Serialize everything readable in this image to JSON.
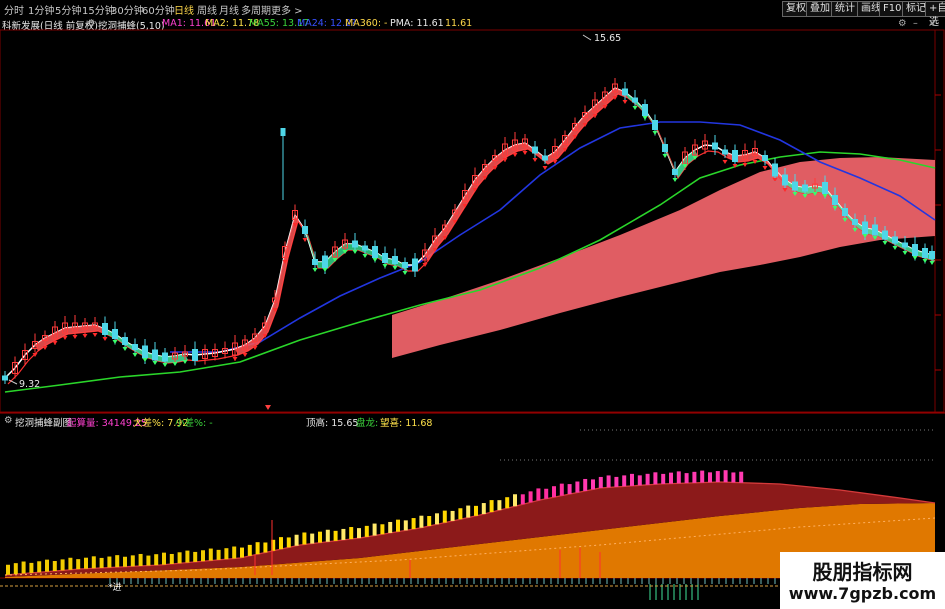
{
  "toolbar": {
    "timeframes": [
      {
        "label": "分时",
        "active": false
      },
      {
        "label": "1分钟",
        "active": false
      },
      {
        "label": "5分钟",
        "active": false
      },
      {
        "label": "15分钟",
        "active": false
      },
      {
        "label": "30分钟",
        "active": false
      },
      {
        "label": "60分钟",
        "active": false
      },
      {
        "label": "日线",
        "active": true
      },
      {
        "label": "周线",
        "active": false
      },
      {
        "label": "月线",
        "active": false
      },
      {
        "label": "多周期",
        "active": false
      },
      {
        "label": "更多 >",
        "active": false
      }
    ],
    "right_buttons": [
      "复权",
      "叠加",
      "统计",
      "画线",
      "F10",
      "标记",
      "+自选"
    ]
  },
  "main_legend": {
    "stock": "科新发展(日线 前复权)",
    "indicator": "挖洞捕蜂(5,10)",
    "ma1": "MA1: 11.61",
    "ma2": "MA2: 11.78",
    "ma55": "MA55: 13.17",
    "ma24": "MA24: 12.2?",
    "ma360": "MA360: -",
    "pma": "PMA: 11.61",
    "pma2": "11.61"
  },
  "price_labels": {
    "high": "15.65",
    "low": "9.32"
  },
  "sub_legend": {
    "title": "挖洞捕蜂副图",
    "qisuan": "起算量: 34149.25",
    "dacha": "大差%: 7.92",
    "xiaocha": "小差%: -",
    "dinggao": "顶高: 15.65",
    "panlong": "盘龙: -",
    "wangxi": "望喜: 11.68"
  },
  "sub_marker": "*进",
  "colors": {
    "up": "#ff3b3b",
    "down": "#4ed6e8",
    "ma1": "#ffffff",
    "ma55": "#2236e0",
    "ma24": "#2ad62a",
    "cloud": "#e05d63",
    "ribbon_green": "#3fe59a",
    "sub_dark": "#8c1a1a",
    "sub_orange": "#e07800",
    "bar_yellow": "#ffd700",
    "bar_pink": "#ff2fa0"
  },
  "watermark": {
    "line1": "股朋指标网",
    "line2": "www.7gpzb.com"
  }
}
